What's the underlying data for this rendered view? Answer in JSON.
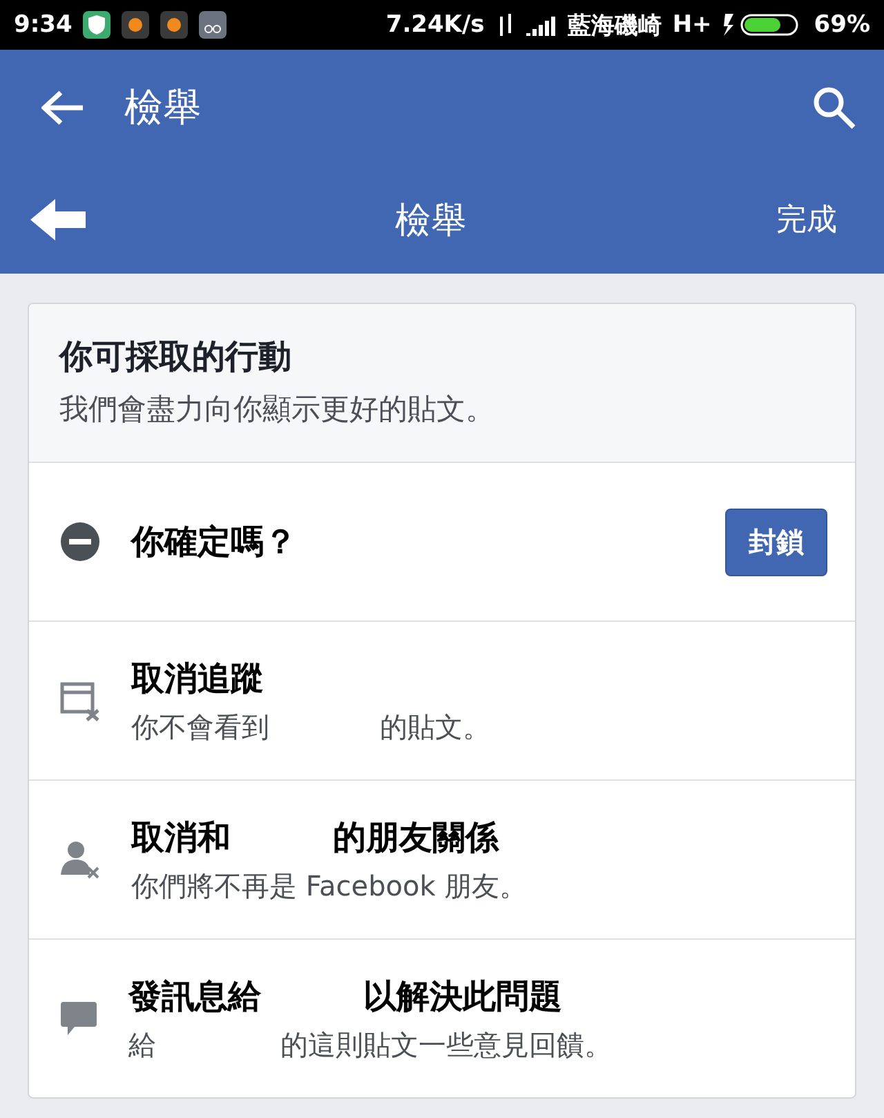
{
  "status_bar": {
    "time": "9:34",
    "speed": "7.24K/s",
    "carrier": "藍海磯崎",
    "network": "H+",
    "battery": "69%"
  },
  "app_bar": {
    "title": "檢舉"
  },
  "sub_bar": {
    "title": "檢舉",
    "done": "完成"
  },
  "card": {
    "title": "你可採取的行動",
    "subtitle": "我們會盡力向你顯示更好的貼文。"
  },
  "actions": [
    {
      "kind": "block",
      "title_parts": [
        "你確定嗎？"
      ],
      "button": "封鎖"
    },
    {
      "kind": "unfollow",
      "title_parts": [
        "取消追蹤"
      ],
      "subtitle_parts": [
        "你不會看到",
        "的貼文。"
      ]
    },
    {
      "kind": "unfriend",
      "title_parts": [
        "取消和",
        "的朋友關係"
      ],
      "subtitle_parts": [
        "你們將不再是 Facebook 朋友。"
      ]
    },
    {
      "kind": "message",
      "title_parts": [
        "發訊息給",
        "以解決此問題"
      ],
      "subtitle_parts": [
        "給",
        "的這則貼文一些意見回饋。"
      ]
    }
  ]
}
